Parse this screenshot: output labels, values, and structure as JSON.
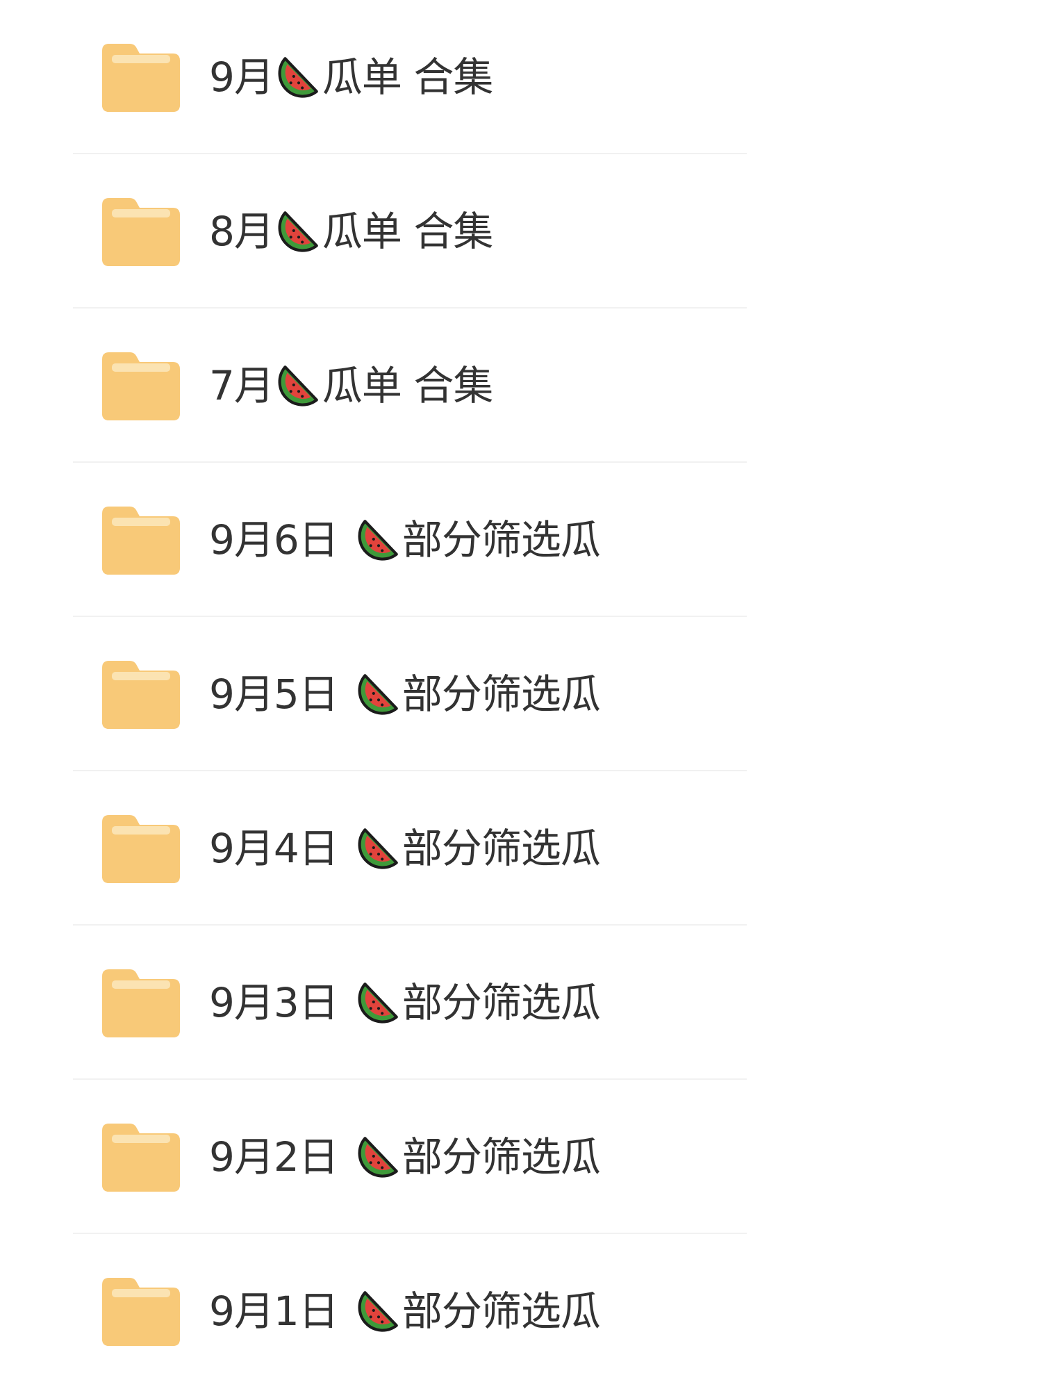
{
  "files": [
    {
      "date": "9月",
      "suffix": "瓜单 合集",
      "icon": "watermelon-icon"
    },
    {
      "date": "8月",
      "suffix": "瓜单 合集",
      "icon": "watermelon-icon"
    },
    {
      "date": "7月",
      "suffix": "瓜单 合集",
      "icon": "watermelon-icon"
    },
    {
      "date": "9月6日",
      "suffix": "部分筛选瓜",
      "icon": "watermelon-icon"
    },
    {
      "date": "9月5日",
      "suffix": "部分筛选瓜",
      "icon": "watermelon-icon"
    },
    {
      "date": "9月4日",
      "suffix": "部分筛选瓜",
      "icon": "watermelon-icon"
    },
    {
      "date": "9月3日",
      "suffix": "部分筛选瓜",
      "icon": "watermelon-icon"
    },
    {
      "date": "9月2日",
      "suffix": "部分筛选瓜",
      "icon": "watermelon-icon"
    },
    {
      "date": "9月1日",
      "suffix": "部分筛选瓜",
      "icon": "watermelon-icon"
    }
  ],
  "colors": {
    "folder": "#F8C978",
    "folder_tab": "#FBE3B2",
    "text": "#333333",
    "divider": "#F1F1F1"
  }
}
